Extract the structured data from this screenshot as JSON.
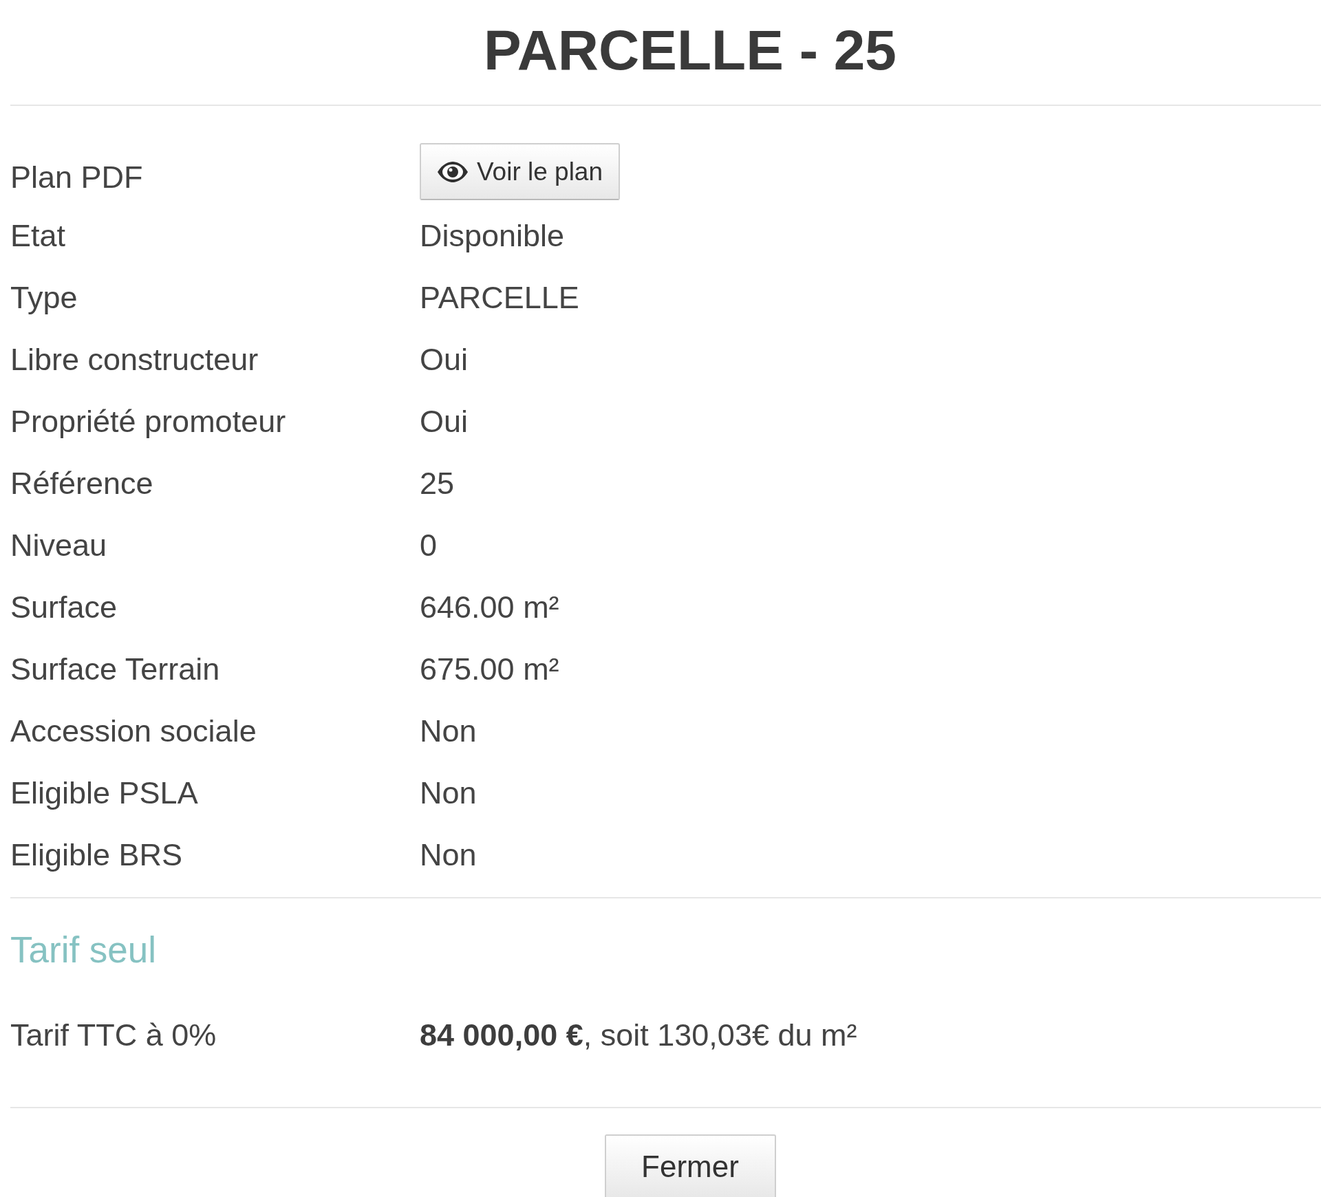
{
  "title": "PARCELLE - 25",
  "details": [
    {
      "label": "Plan PDF",
      "kind": "button",
      "value": "Voir le plan"
    },
    {
      "label": "Etat",
      "kind": "text",
      "value": "Disponible"
    },
    {
      "label": "Type",
      "kind": "text",
      "value": "PARCELLE"
    },
    {
      "label": "Libre constructeur",
      "kind": "text",
      "value": "Oui"
    },
    {
      "label": "Propriété promoteur",
      "kind": "text",
      "value": "Oui"
    },
    {
      "label": "Référence",
      "kind": "text",
      "value": "25"
    },
    {
      "label": "Niveau",
      "kind": "text",
      "value": "0"
    },
    {
      "label": "Surface",
      "kind": "text",
      "value": "646.00 m²"
    },
    {
      "label": "Surface Terrain",
      "kind": "text",
      "value": "675.00 m²"
    },
    {
      "label": "Accession sociale",
      "kind": "text",
      "value": "Non"
    },
    {
      "label": "Eligible PSLA",
      "kind": "text",
      "value": "Non"
    },
    {
      "label": "Eligible BRS",
      "kind": "text",
      "value": "Non"
    }
  ],
  "pricing": {
    "heading": "Tarif seul",
    "rows": [
      {
        "label": "Tarif TTC à 0%",
        "value": "**84 000,00 €**, soit 130,03€ du m²"
      }
    ]
  },
  "footer": {
    "close_button": "Fermer"
  }
}
